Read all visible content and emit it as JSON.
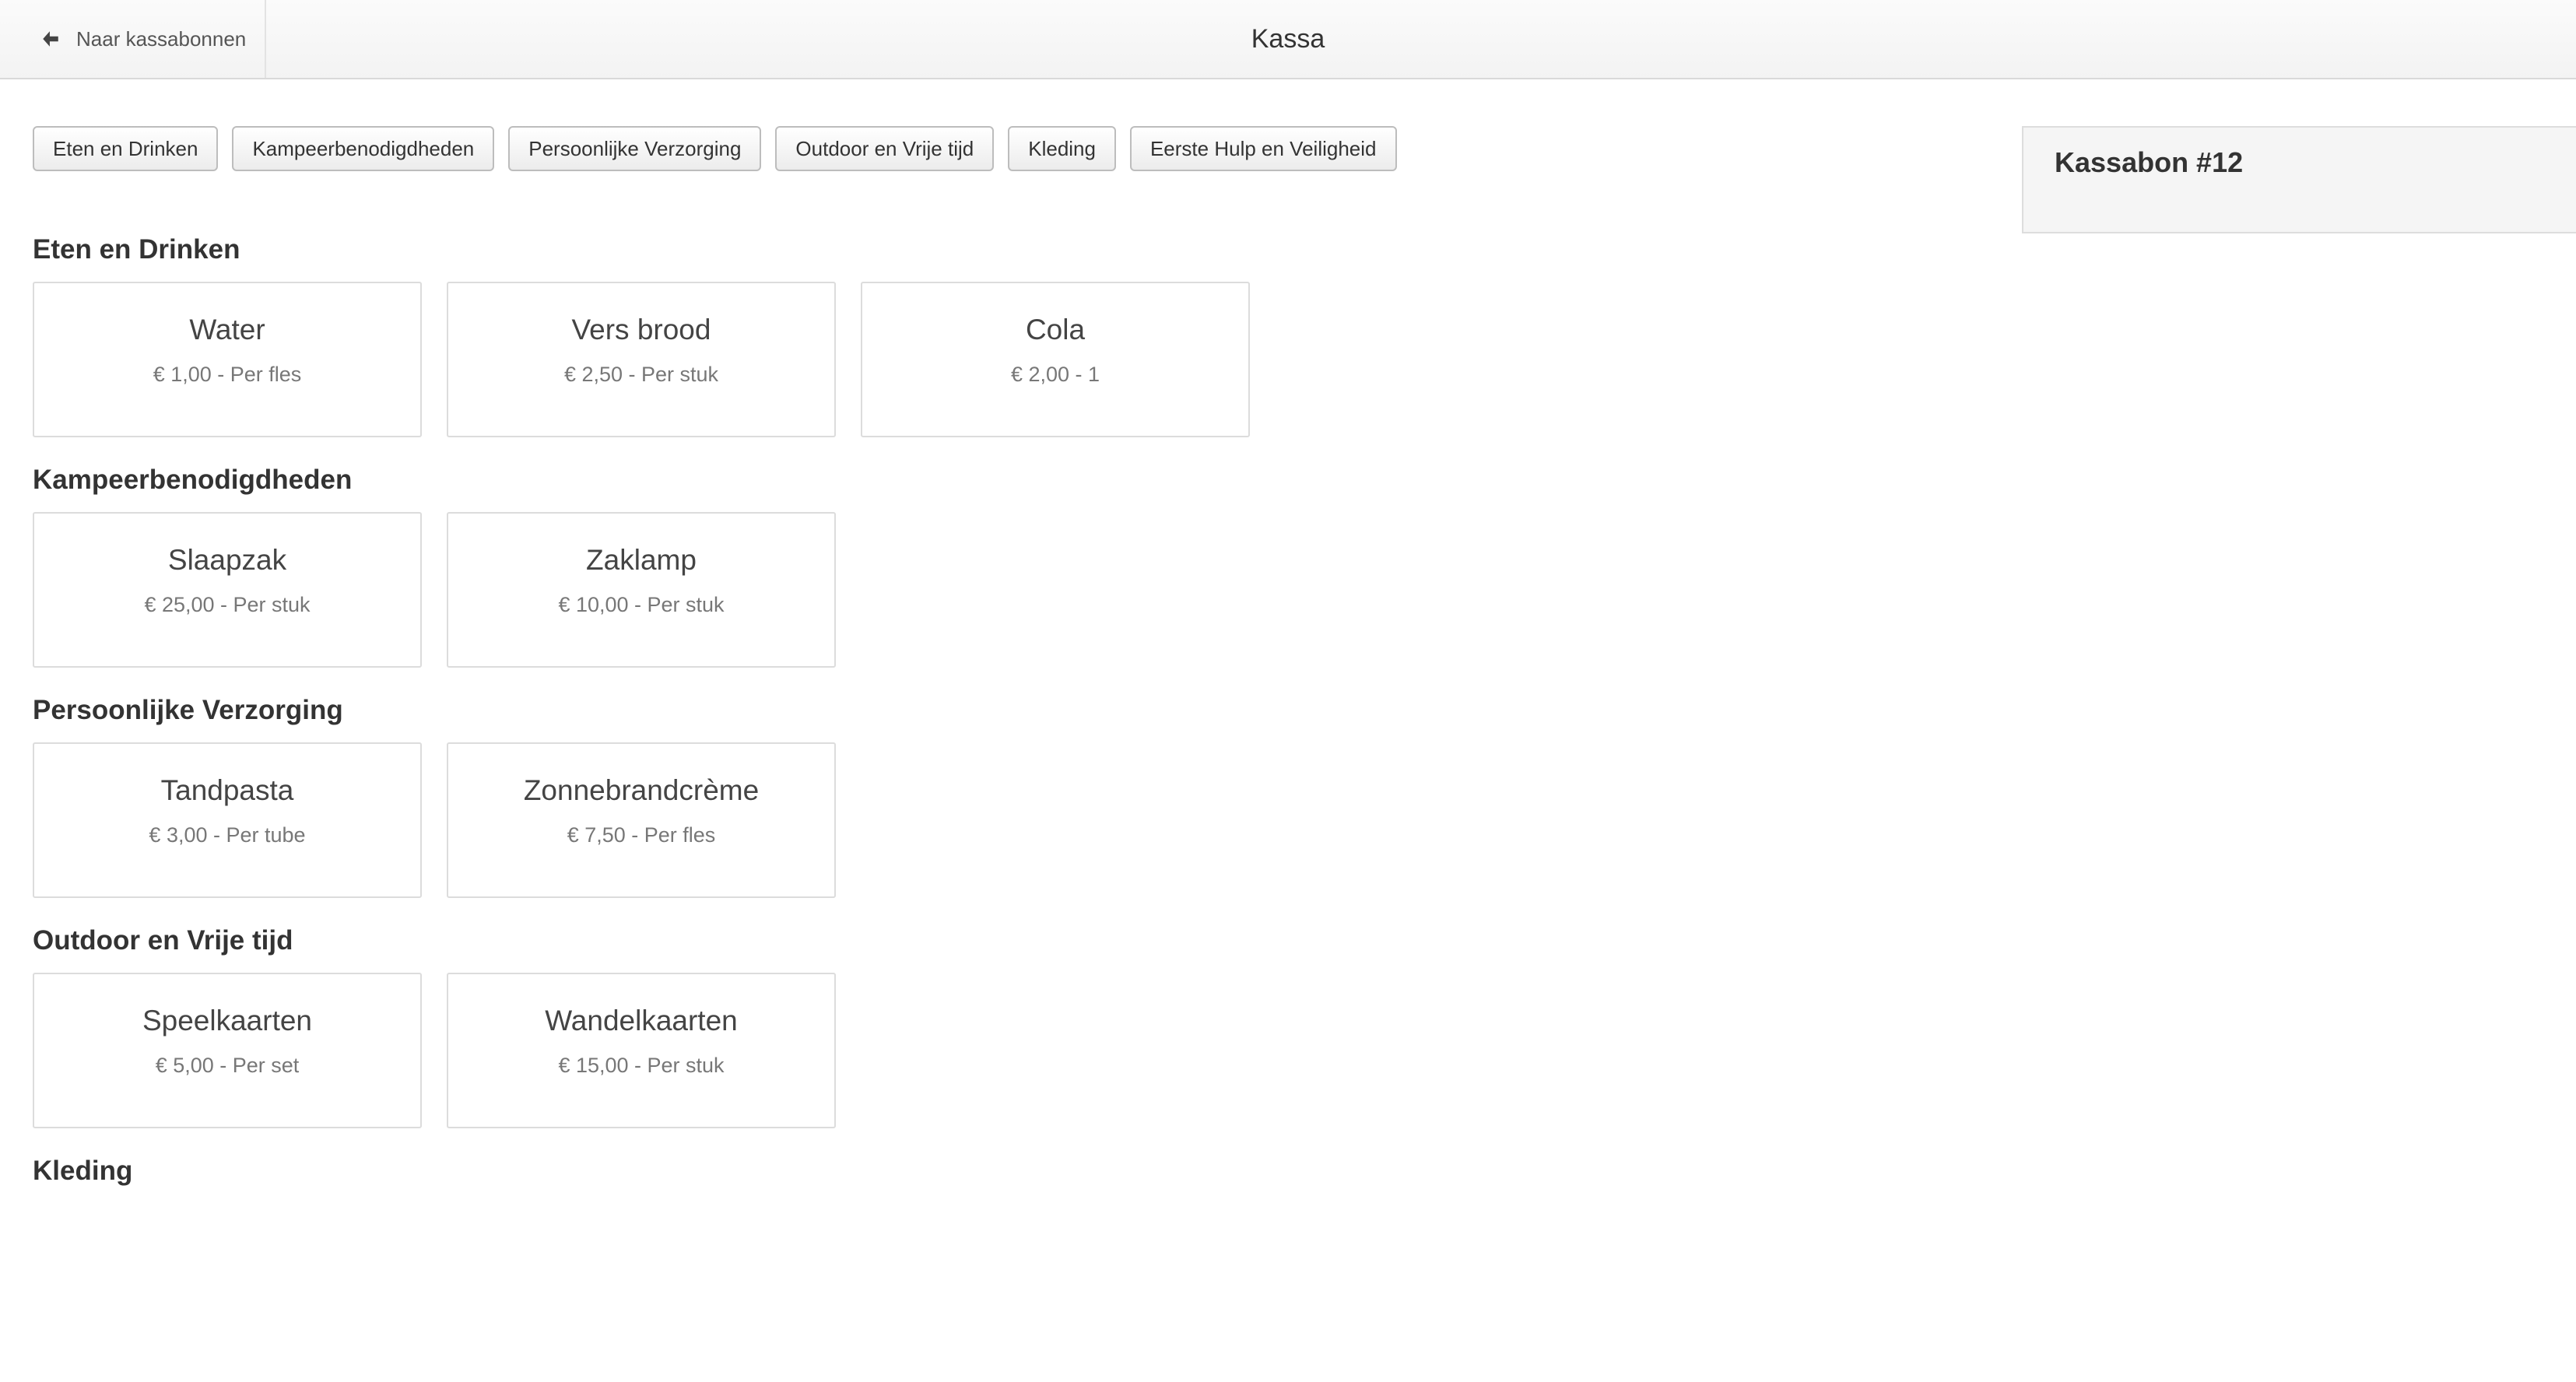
{
  "header": {
    "back_label": "Naar kassabonnen",
    "title": "Kassa"
  },
  "category_buttons": [
    "Eten en Drinken",
    "Kampeerbenodigdheden",
    "Persoonlijke Verzorging",
    "Outdoor en Vrije tijd",
    "Kleding",
    "Eerste Hulp en Veiligheid"
  ],
  "sections": [
    {
      "title": "Eten en Drinken",
      "products": [
        {
          "name": "Water",
          "price": "€ 1,00 - Per fles"
        },
        {
          "name": "Vers brood",
          "price": "€ 2,50 - Per stuk"
        },
        {
          "name": "Cola",
          "price": "€ 2,00 - 1"
        }
      ]
    },
    {
      "title": "Kampeerbenodigdheden",
      "products": [
        {
          "name": "Slaapzak",
          "price": "€ 25,00 - Per stuk"
        },
        {
          "name": "Zaklamp",
          "price": "€ 10,00 - Per stuk"
        }
      ]
    },
    {
      "title": "Persoonlijke Verzorging",
      "products": [
        {
          "name": "Tandpasta",
          "price": "€ 3,00 - Per tube"
        },
        {
          "name": "Zonnebrandcrème",
          "price": "€ 7,50 - Per fles"
        }
      ]
    },
    {
      "title": "Outdoor en Vrije tijd",
      "products": [
        {
          "name": "Speelkaarten",
          "price": "€ 5,00 - Per set"
        },
        {
          "name": "Wandelkaarten",
          "price": "€ 15,00 - Per stuk"
        }
      ]
    },
    {
      "title": "Kleding",
      "products": []
    }
  ],
  "receipt": {
    "title": "Kassabon #12"
  },
  "icons": {
    "back": "arrow-left-icon"
  },
  "colors": {
    "topbar_bg": "#f5f5f5",
    "card_border": "#dcdcdc",
    "receipt_bg": "#f5f5f5"
  }
}
